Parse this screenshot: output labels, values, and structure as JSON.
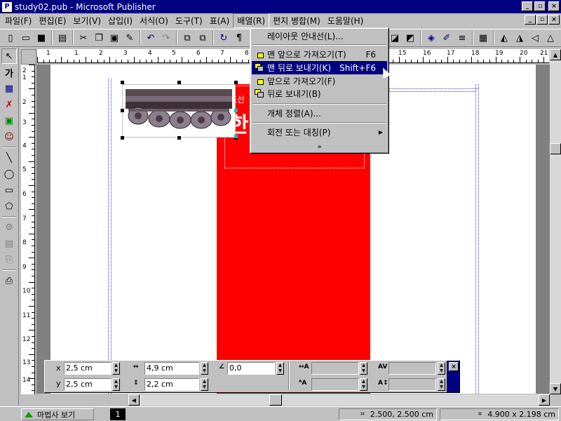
{
  "window": {
    "title": "study02.pub - Microsoft Publisher",
    "app_icon_letter": "P",
    "controls": [
      "_",
      "▫",
      "×"
    ]
  },
  "menubar": {
    "items": [
      "파일(F)",
      "편집(E)",
      "보기(V)",
      "삽입(I)",
      "서식(O)",
      "도구(T)",
      "표(A)",
      "배열(R)",
      "편지 병합(M)",
      "도움말(H)"
    ],
    "active_index": 7,
    "doc_controls": [
      "_",
      "▫",
      "×"
    ]
  },
  "toolbar": {
    "left_icons": [
      "new-icon",
      "open-icon",
      "save-icon",
      "print-icon",
      "cut-icon",
      "copy-icon",
      "paste-icon",
      "format-painter-icon",
      "undo-icon",
      "redo-icon",
      "bring-front-icon",
      "send-back-icon",
      "rotate-icon",
      "paragraph-icon"
    ],
    "right_icons": [
      "fill-color-icon",
      "line-color-icon",
      "line-style-icon",
      "shadow-icon",
      "rotate-left-icon",
      "rotate-right-icon",
      "flip-horizontal-icon",
      "flip-vertical-icon"
    ]
  },
  "left_tools": [
    "pointer-icon",
    "text-frame-icon",
    "table-frame-icon",
    "wordart-frame-icon",
    "picture-frame-icon",
    "clipart-frame-icon",
    "line-icon",
    "oval-icon",
    "rectangle-icon",
    "custom-shape-icon",
    "ole-object-icon",
    "design-gallery-icon",
    "form-control-icon",
    "page-nav-icon"
  ],
  "hruler": {
    "labels": [
      "1",
      "1",
      "2",
      "3",
      "4",
      "5",
      "6",
      "7",
      "8",
      "15",
      "16",
      "17",
      "18",
      "19",
      "20",
      "21"
    ]
  },
  "vruler": {
    "labels": [
      "2",
      "1",
      "2",
      "3",
      "4",
      "5",
      "6",
      "7",
      "8",
      "9",
      "10",
      "11",
      "12",
      "13",
      "14",
      "15"
    ]
  },
  "document": {
    "red_text_line1": "조선",
    "red_text_line2": "한",
    "colors": {
      "red_panel": "#ff0000",
      "page": "#ffffff",
      "workspace": "#808080"
    }
  },
  "arrange_menu": {
    "items": [
      {
        "label": "레이아웃 안내선(L)...",
        "shortcut": "",
        "icon": "",
        "submenu": false
      },
      {
        "label": "맨 앞으로 가져오기(T)",
        "shortcut": "F6",
        "icon": "bring-to-front-icon",
        "submenu": false
      },
      {
        "label": "맨 뒤로 보내기(K)",
        "shortcut": "Shift+F6",
        "icon": "send-to-back-icon",
        "submenu": false
      },
      {
        "label": "앞으로 가져오기(F)",
        "shortcut": "",
        "icon": "bring-forward-icon",
        "submenu": false
      },
      {
        "label": "뒤로 보내기(B)",
        "shortcut": "",
        "icon": "send-backward-icon",
        "submenu": false
      },
      {
        "label": "개체 정렬(A)...",
        "shortcut": "",
        "icon": "",
        "submenu": false
      },
      {
        "label": "회전 또는 대칭(P)",
        "shortcut": "",
        "icon": "",
        "submenu": true
      }
    ],
    "highlighted_index": 2,
    "more_glyph": "»"
  },
  "measurement": {
    "x_label": "x",
    "x_value": "2,5 cm",
    "y_label": "y",
    "y_value": "2,5 cm",
    "width_value": "4,9 cm",
    "height_value": "2,2 cm",
    "angle_value": "0,0",
    "close_glyph": "×"
  },
  "statusbar": {
    "wizard_label": "마법사 보기",
    "page_number": "1",
    "position": "2.500, 2.500 cm",
    "size": "4.900 x  2.198 cm"
  }
}
